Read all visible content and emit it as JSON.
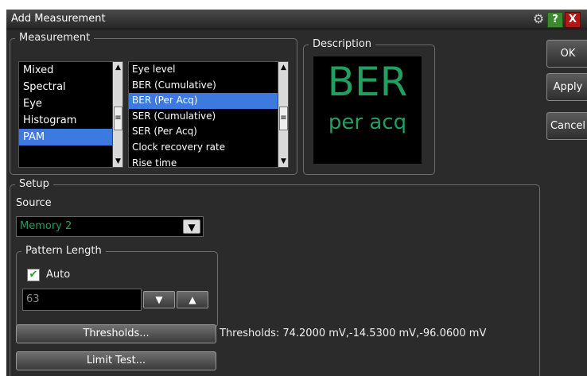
{
  "window": {
    "title": "Add Measurement",
    "help_label": "?",
    "close_label": "X"
  },
  "measurement_group": {
    "legend": "Measurement",
    "categories": [
      {
        "label": "Mixed",
        "selected": false
      },
      {
        "label": "Spectral",
        "selected": false
      },
      {
        "label": "Eye",
        "selected": false
      },
      {
        "label": "Histogram",
        "selected": false
      },
      {
        "label": "PAM",
        "selected": true
      }
    ],
    "measurements": [
      {
        "label": "Eye level",
        "selected": false
      },
      {
        "label": "BER (Cumulative)",
        "selected": false
      },
      {
        "label": "BER (Per Acq)",
        "selected": true
      },
      {
        "label": "SER (Cumulative)",
        "selected": false
      },
      {
        "label": "SER (Per Acq)",
        "selected": false
      },
      {
        "label": "Clock recovery rate",
        "selected": false
      },
      {
        "label": "Rise time",
        "selected": false
      }
    ]
  },
  "description_group": {
    "legend": "Description",
    "big_text": "BER",
    "small_text": "per acq",
    "text_color": "#20a060"
  },
  "side_buttons": {
    "ok": "OK",
    "apply": "Apply",
    "cancel": "Cancel"
  },
  "setup_group": {
    "legend": "Setup",
    "source_label": "Source",
    "source_value": "Memory 2",
    "pattern_length": {
      "legend": "Pattern Length",
      "auto_label": "Auto",
      "auto_checked": true,
      "value": "63"
    },
    "thresholds_button": "Thresholds...",
    "thresholds_info": "Thresholds: 74.2000 mV,-14.5300 mV,-96.0600 mV",
    "limit_test_button": "Limit Test..."
  },
  "colors": {
    "selection": "#3d7ae0",
    "accent_green": "#20a060",
    "background": "#2b2b2b"
  }
}
